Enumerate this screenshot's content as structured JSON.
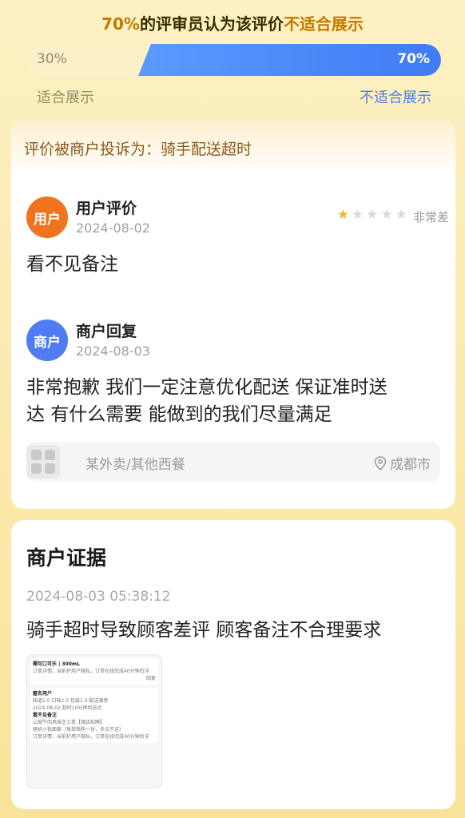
{
  "vote": {
    "title_percent": "70%",
    "title_mid": "的评审员认为该评价",
    "title_end": "不适合展示",
    "left_percent_label": "30%",
    "right_percent_label": "70%",
    "unsuitable_fraction": 0.7,
    "left_side_label": "适合展示",
    "right_side_label": "不适合展示"
  },
  "complaint": {
    "header": "评价被商户投诉为：骑手配送超时"
  },
  "user_review": {
    "avatar_text": "用户",
    "title": "用户评价",
    "date": "2024-08-02",
    "rating": 1,
    "rating_max": 5,
    "rating_label": "非常差",
    "content": "看不见备注"
  },
  "merchant_reply": {
    "avatar_text": "商户",
    "title": "商户回复",
    "date": "2024-08-03",
    "content_line1": "非常抱歉 我们一定注意优化配送 保证准时送",
    "content_line2": "达 有什么需要 能做到的我们尽量满足"
  },
  "shop": {
    "category": "某外卖/其他西餐",
    "location": "成都市"
  },
  "evidence": {
    "title": "商户证据",
    "time": "2024-08-03 05:38:12",
    "text": "骑手超时导致顾客差评 顾客备注不合理要求",
    "screenshot": {
      "line1": "椰可口可乐 | 300mL",
      "line2": "订单详情，当前护用户隐私，订单在线完成40分钟后详",
      "line3": "回复",
      "user": "匿名用户",
      "score": "味道1.0  口味2.0  包装1.0  配送满意",
      "date": "2024-08-02  超时10分钟后送达",
      "review": "看不见备注",
      "item1": "山城牛肉风味芝士卷【镇店招牌】",
      "item2": "随机小批面套（每单限购一份，多点不送）",
      "line4": "订单详情，当前护用户隐私，订单在线完成40分钟后详"
    }
  },
  "colors": {
    "accent": "#c27a00",
    "vote_blue": "#4a7cf0",
    "user_avatar": "#f0731e",
    "merchant_avatar": "#4f7cf2",
    "star_on": "#f2b82b"
  }
}
